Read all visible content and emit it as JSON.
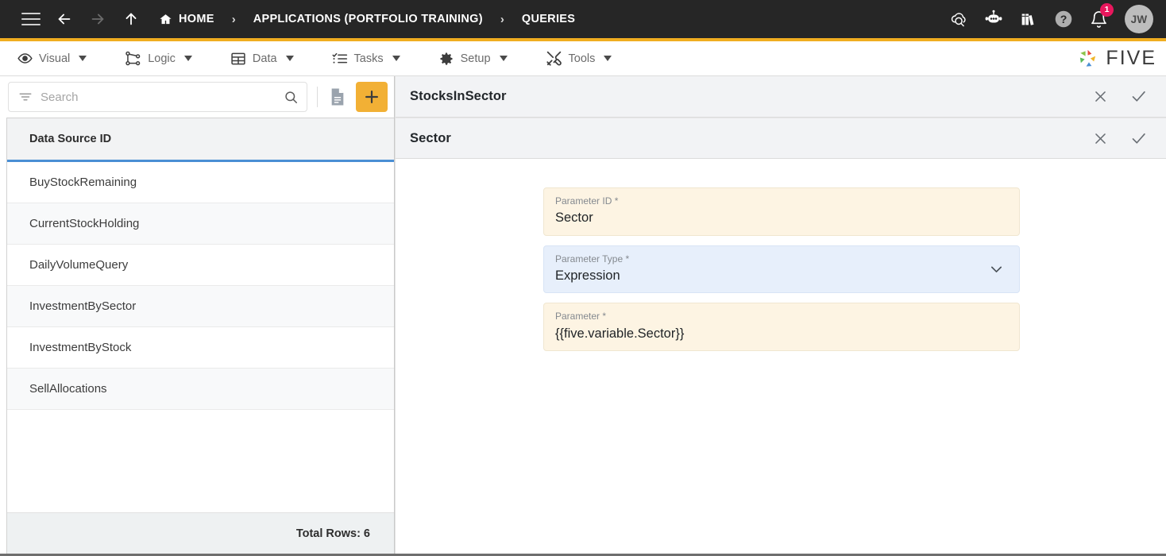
{
  "topbar": {
    "nav": {
      "menu": "menu-icon",
      "back": "back-arrow-icon",
      "forward": "forward-arrow-icon",
      "up": "up-arrow-icon"
    },
    "breadcrumb": [
      {
        "label": "HOME",
        "icon": "home-icon"
      },
      {
        "label": "APPLICATIONS (PORTFOLIO TRAINING)",
        "icon": ""
      },
      {
        "label": "QUERIES",
        "icon": ""
      }
    ],
    "separator": "›",
    "right_icons": [
      {
        "name": "cloud-search-icon"
      },
      {
        "name": "chatbot-icon"
      },
      {
        "name": "library-books-icon"
      },
      {
        "name": "help-icon"
      },
      {
        "name": "notifications-bell-icon",
        "badge": "1"
      }
    ],
    "avatar_initials": "JW",
    "accent_color": "#f0ad20",
    "bar_color": "#262626",
    "badge_color": "#e8175d"
  },
  "menubar": {
    "items": [
      {
        "label": "Visual",
        "icon": "eye-icon"
      },
      {
        "label": "Logic",
        "icon": "logic-nodes-icon"
      },
      {
        "label": "Data",
        "icon": "table-grid-icon"
      },
      {
        "label": "Tasks",
        "icon": "checklist-icon"
      },
      {
        "label": "Setup",
        "icon": "gear-icon"
      },
      {
        "label": "Tools",
        "icon": "tools-icon"
      }
    ],
    "brand": "FIVE"
  },
  "left_pane": {
    "search": {
      "placeholder": "Search",
      "value": "",
      "filter_icon": "filter-icon",
      "search_icon": "search-icon"
    },
    "toolbar": {
      "document_button": "document-icon",
      "add_button": "plus-icon",
      "add_button_color": "#f2b035"
    },
    "grid": {
      "column_header": "Data Source ID",
      "header_underline_color": "#4a8fd4",
      "rows": [
        "BuyStockRemaining",
        "CurrentStockHolding",
        "DailyVolumeQuery",
        "InvestmentBySector",
        "InvestmentByStock",
        "SellAllocations"
      ],
      "footer": "Total Rows: 6"
    }
  },
  "right_pane": {
    "panels": [
      {
        "title": "StocksInSector",
        "close_icon": "close-icon",
        "confirm_icon": "check-icon"
      },
      {
        "title": "Sector",
        "close_icon": "close-icon",
        "confirm_icon": "check-icon"
      }
    ],
    "form": {
      "fields": [
        {
          "label": "Parameter ID *",
          "value": "Sector",
          "style": "cream",
          "type": "text"
        },
        {
          "label": "Parameter Type *",
          "value": "Expression",
          "style": "blue",
          "type": "select",
          "chevron": "chevron-down-icon"
        },
        {
          "label": "Parameter *",
          "value": "{{five.variable.Sector}}",
          "style": "cream",
          "type": "text"
        }
      ]
    }
  }
}
